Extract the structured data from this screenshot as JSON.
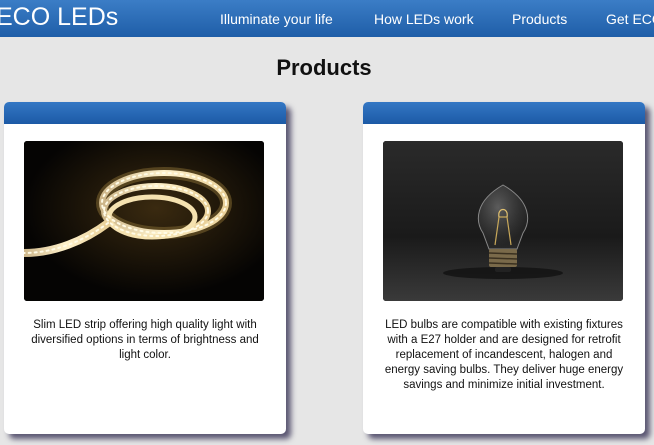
{
  "header": {
    "brand": "ECO LEDs",
    "nav": [
      {
        "label": "Illuminate your life"
      },
      {
        "label": "How LEDs work"
      },
      {
        "label": "Products"
      },
      {
        "label": "Get ECO"
      }
    ]
  },
  "main": {
    "title": "Products",
    "cards": [
      {
        "image": "led-strip-image",
        "description": "Slim LED strip offering high quality light with diversified options in terms of brightness and light color."
      },
      {
        "image": "led-bulb-image",
        "description": "LED bulbs are compatible with existing fixtures with a E27 holder and are designed for retrofit replacement of incandescent, halogen and energy saving bulbs. They deliver huge energy savings and minimize initial investment."
      }
    ]
  },
  "colors": {
    "navbar": "#2a6bb8",
    "card_header": "#2a6bb8",
    "background": "#e6e6e6",
    "card_shadow": "#5a5672"
  }
}
